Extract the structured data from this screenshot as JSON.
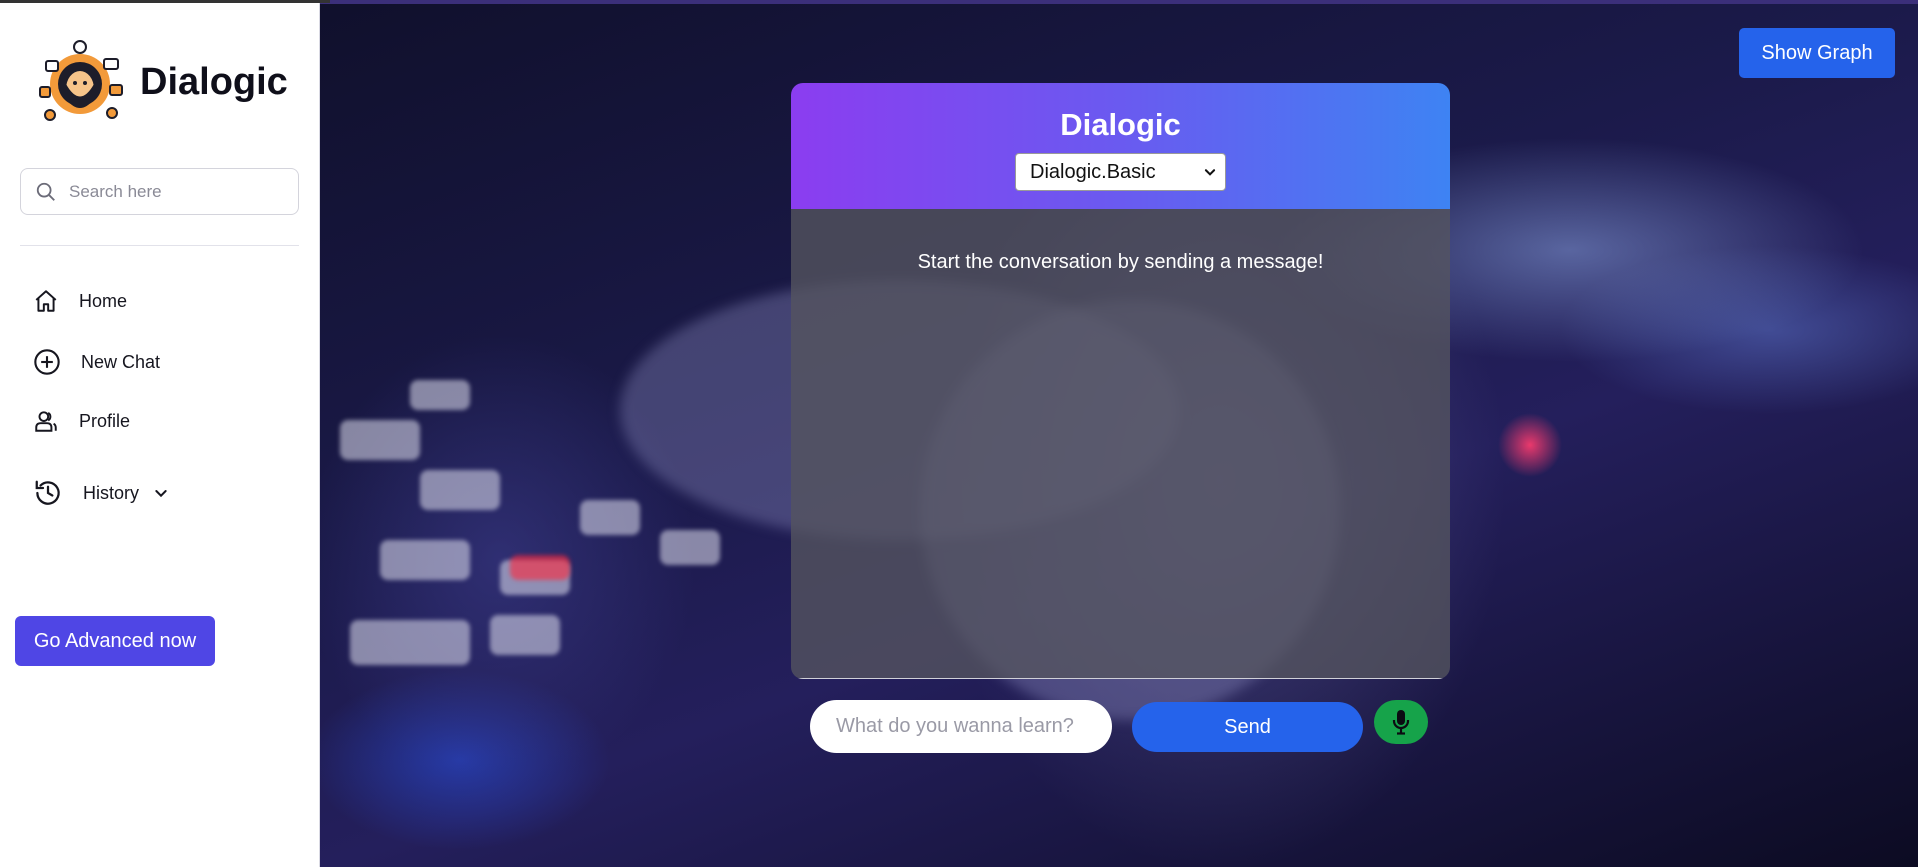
{
  "sidebar": {
    "brand": "Dialogic",
    "search_placeholder": "Search here",
    "nav": [
      {
        "label": "Home"
      },
      {
        "label": "New Chat"
      },
      {
        "label": "Profile"
      },
      {
        "label": "History"
      }
    ],
    "advanced_label": "Go Advanced now"
  },
  "header": {
    "show_graph_label": "Show Graph"
  },
  "chat": {
    "title": "Dialogic",
    "model_selected": "Dialogic.Basic",
    "empty_message": "Start the conversation by sending a message!",
    "input_placeholder": "What do you wanna learn?",
    "send_label": "Send"
  },
  "icons": {
    "search": "search-icon",
    "home": "home-icon",
    "new_chat": "plus-circle-icon",
    "profile": "users-icon",
    "history": "history-icon",
    "chevron": "chevron-down-icon",
    "mic": "microphone-icon"
  },
  "colors": {
    "primary": "#2563eb",
    "advanced": "#4f46e5",
    "mic": "#16a34a",
    "header_gradient_start": "#8b3df0",
    "header_gradient_end": "#3e83f3"
  }
}
